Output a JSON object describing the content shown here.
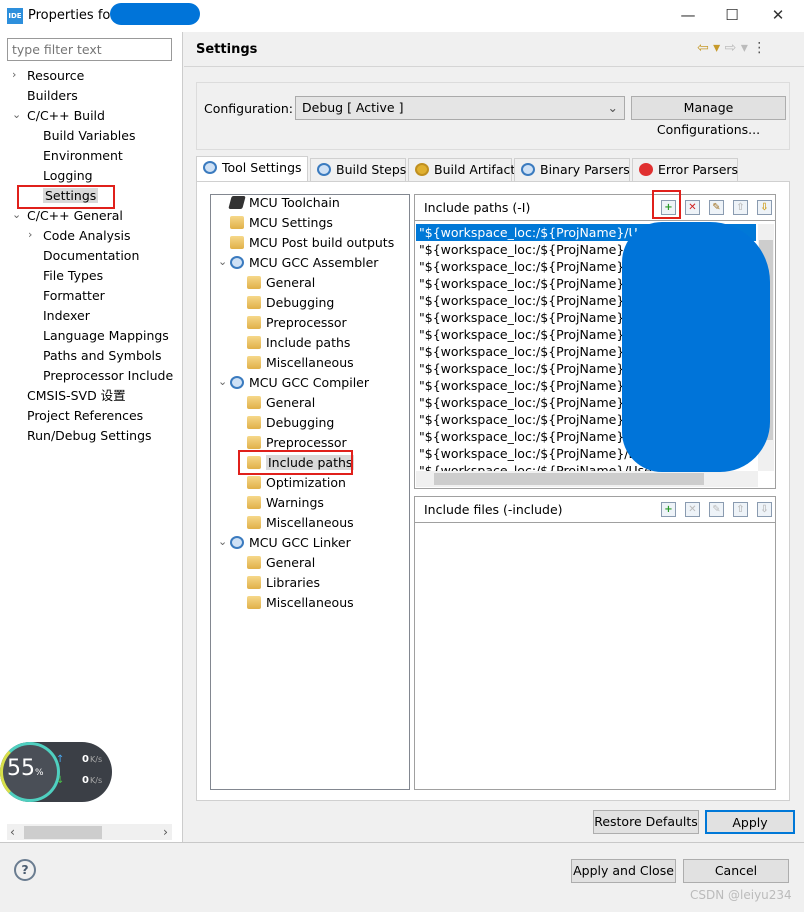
{
  "window": {
    "title": "Properties for",
    "icon_label": "IDE",
    "minimize": "—",
    "maximize": "☐",
    "close": "✕"
  },
  "sidebar": {
    "filter_placeholder": "type filter text",
    "items": [
      {
        "label": "Resource",
        "level": 0,
        "expander": "›"
      },
      {
        "label": "Builders",
        "level": 0
      },
      {
        "label": "C/C++ Build",
        "level": 0,
        "expander": "⌄"
      },
      {
        "label": "Build Variables",
        "level": 1
      },
      {
        "label": "Environment",
        "level": 1
      },
      {
        "label": "Logging",
        "level": 1
      },
      {
        "label": "Settings",
        "level": 1,
        "selected": true
      },
      {
        "label": "C/C++ General",
        "level": 0,
        "expander": "⌄"
      },
      {
        "label": "Code Analysis",
        "level": 1,
        "expander": "›"
      },
      {
        "label": "Documentation",
        "level": 1
      },
      {
        "label": "File Types",
        "level": 1
      },
      {
        "label": "Formatter",
        "level": 1
      },
      {
        "label": "Indexer",
        "level": 1
      },
      {
        "label": "Language Mappings",
        "level": 1
      },
      {
        "label": "Paths and Symbols",
        "level": 1
      },
      {
        "label": "Preprocessor Include",
        "level": 1
      },
      {
        "label": "CMSIS-SVD 设置",
        "level": 0
      },
      {
        "label": "Project References",
        "level": 0
      },
      {
        "label": "Run/Debug Settings",
        "level": 0
      }
    ]
  },
  "main": {
    "title": "Settings",
    "configuration_label": "Configuration:",
    "configuration_value": "Debug  [ Active ]",
    "manage_button": "Manage Configurations...",
    "tabs": [
      {
        "label": "Tool Settings",
        "active": true
      },
      {
        "label": "Build Steps"
      },
      {
        "label": "Build Artifact"
      },
      {
        "label": "Binary Parsers"
      },
      {
        "label": "Error Parsers"
      }
    ],
    "tool_tree": [
      {
        "label": "MCU Toolchain",
        "level": 0,
        "icon": "chip"
      },
      {
        "label": "MCU Settings",
        "level": 0,
        "icon": "folder"
      },
      {
        "label": "MCU Post build outputs",
        "level": 0,
        "icon": "folder"
      },
      {
        "label": "MCU GCC Assembler",
        "level": 0,
        "icon": "gear",
        "expander": "⌄"
      },
      {
        "label": "General",
        "level": 1,
        "icon": "folder"
      },
      {
        "label": "Debugging",
        "level": 1,
        "icon": "folder"
      },
      {
        "label": "Preprocessor",
        "level": 1,
        "icon": "folder"
      },
      {
        "label": "Include paths",
        "level": 1,
        "icon": "folder"
      },
      {
        "label": "Miscellaneous",
        "level": 1,
        "icon": "folder"
      },
      {
        "label": "MCU GCC Compiler",
        "level": 0,
        "icon": "gear",
        "expander": "⌄"
      },
      {
        "label": "General",
        "level": 1,
        "icon": "folder"
      },
      {
        "label": "Debugging",
        "level": 1,
        "icon": "folder"
      },
      {
        "label": "Preprocessor",
        "level": 1,
        "icon": "folder"
      },
      {
        "label": "Include paths",
        "level": 1,
        "icon": "folder",
        "selected": true
      },
      {
        "label": "Optimization",
        "level": 1,
        "icon": "folder"
      },
      {
        "label": "Warnings",
        "level": 1,
        "icon": "folder"
      },
      {
        "label": "Miscellaneous",
        "level": 1,
        "icon": "folder"
      },
      {
        "label": "MCU GCC Linker",
        "level": 0,
        "icon": "gear",
        "expander": "⌄"
      },
      {
        "label": "General",
        "level": 1,
        "icon": "folder"
      },
      {
        "label": "Libraries",
        "level": 1,
        "icon": "folder"
      },
      {
        "label": "Miscellaneous",
        "level": 1,
        "icon": "folder"
      }
    ],
    "include_paths": {
      "title": "Include paths (-I)",
      "items": [
        "\"${workspace_loc:/${ProjName}/User}\"",
        "\"${workspace_loc:/${ProjName}/Lib",
        "\"${workspace_loc:/${ProjName}/BS",
        "\"${workspace_loc:/${ProjName}/BS",
        "\"${workspace_loc:/${ProjName}/BS",
        "\"${workspace_loc:/${ProjName}/Ha",
        "\"${workspace_loc:/${ProjName}/Har",
        "\"${workspace_loc:/${ProjName}/Har",
        "\"${workspace_loc:/${ProjName}/Har",
        "\"${workspace_loc:/${ProjName}/Ha",
        "\"${workspace_loc:/${ProjName}/Ha",
        "\"${workspace_loc:/${ProjName}/Us",
        "\"${workspace_loc:/${ProjName}/Lib",
        "\"${workspace_loc:/${ProjName}/Lib",
        "\"${workspace_loc:/${ProjName}/Use"
      ]
    },
    "include_files": {
      "title": "Include files (-include)"
    },
    "toolbar_icons": [
      "add-icon",
      "delete-icon",
      "edit-icon",
      "move-up-icon",
      "move-down-icon"
    ],
    "restore_defaults": "Restore Defaults",
    "apply": "Apply"
  },
  "footer": {
    "help": "?",
    "apply_and_close": "Apply and Close",
    "cancel": "Cancel",
    "watermark": "CSDN @leiyu234"
  },
  "overlay_widget": {
    "percent": "55",
    "percent_unit": "%",
    "upload": "0",
    "download": "0",
    "unit": "K/s"
  },
  "colors": {
    "selection": "#0078d7",
    "highlight_box": "#e0201b",
    "redaction": "#0074d9"
  }
}
